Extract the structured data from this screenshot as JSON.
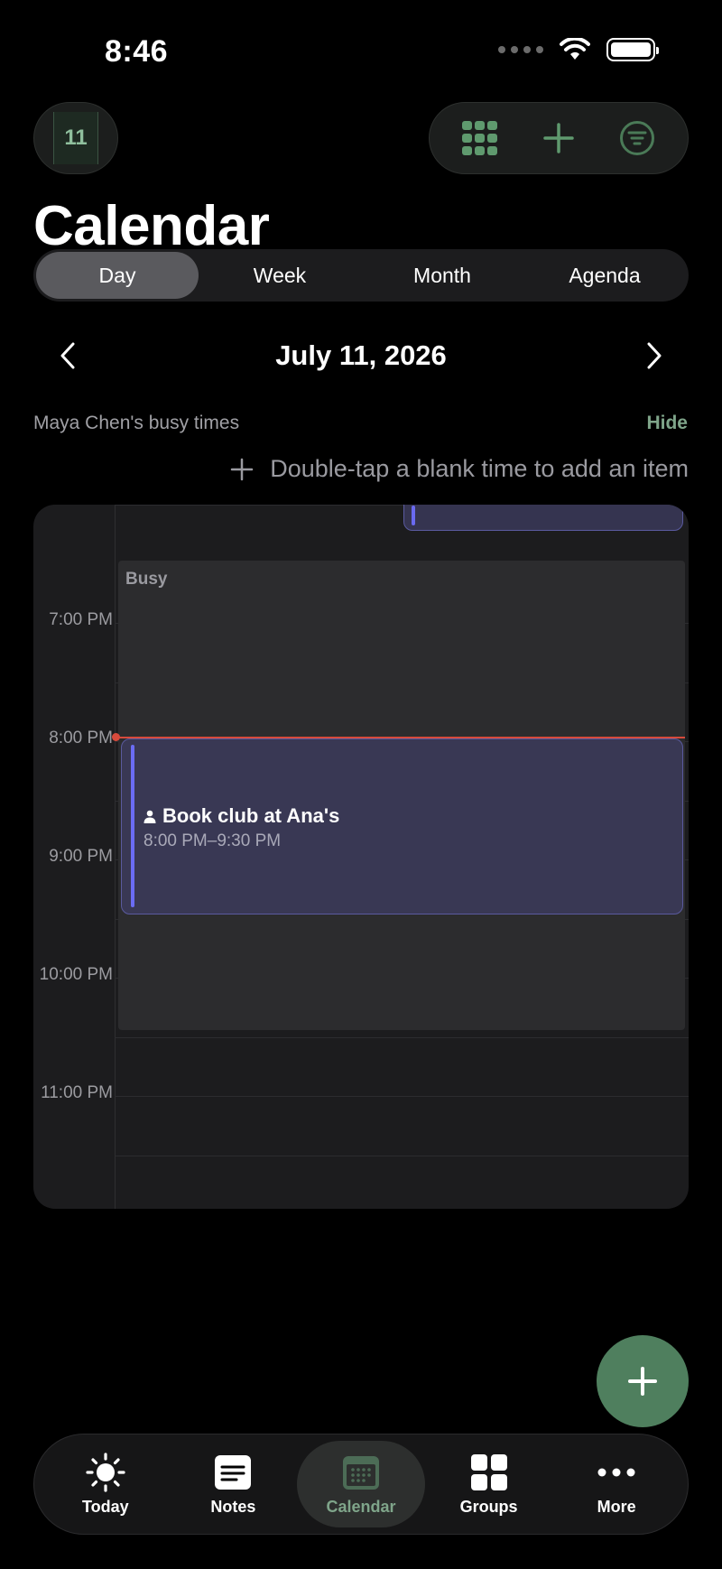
{
  "status_bar": {
    "time": "8:46"
  },
  "header": {
    "date_chip": "11",
    "title": "Calendar",
    "actions": [
      {
        "name": "grid-icon"
      },
      {
        "name": "plus-icon"
      },
      {
        "name": "filter-icon"
      }
    ]
  },
  "view_switcher": {
    "options": [
      "Day",
      "Week",
      "Month",
      "Agenda"
    ],
    "selected": "Day"
  },
  "date_nav": {
    "current": "July 11, 2026"
  },
  "busy_overlay": {
    "owner_label": "Maya Chen's busy times",
    "hide_label": "Hide"
  },
  "hint": {
    "text": "Double-tap a blank time to add an item"
  },
  "day_view": {
    "hours": [
      "7:00 PM",
      "8:00 PM",
      "9:00 PM",
      "10:00 PM",
      "11:00 PM"
    ],
    "busy_label": "Busy",
    "events": [
      {
        "title": "Book club at Ana's",
        "time": "8:00 PM–9:30 PM",
        "color": "#6b6cf4"
      }
    ]
  },
  "tab_bar": {
    "tabs": [
      {
        "label": "Today",
        "icon": "sun-icon"
      },
      {
        "label": "Notes",
        "icon": "notes-icon"
      },
      {
        "label": "Calendar",
        "icon": "calendar-icon"
      },
      {
        "label": "Groups",
        "icon": "groups-icon"
      },
      {
        "label": "More",
        "icon": "more-icon"
      }
    ],
    "selected": "Calendar"
  },
  "colors": {
    "accent": "#7fa58a",
    "fab": "#4f7f5e",
    "now_line": "#d74a3c",
    "event": "#6b6cf4"
  }
}
